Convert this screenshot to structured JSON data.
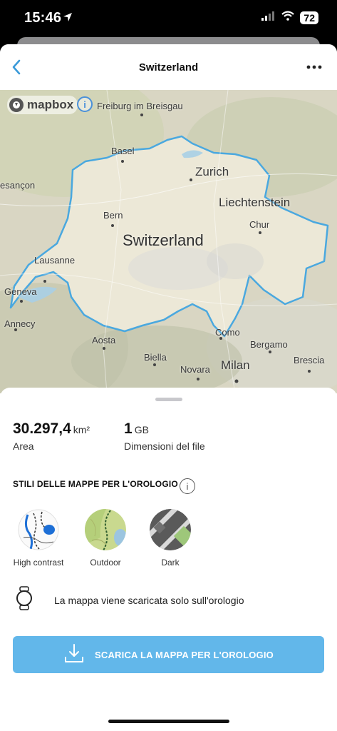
{
  "status_bar": {
    "time": "15:46",
    "battery": "72"
  },
  "header": {
    "title": "Switzerland"
  },
  "map": {
    "attribution": "mapbox",
    "labels": {
      "freiburg": "Freiburg im Breisgau",
      "basel": "Basel",
      "zurich": "Zurich",
      "besancon": "esançon",
      "liechtenstein": "Liechtenstein",
      "bern": "Bern",
      "chur": "Chur",
      "switzerland": "Switzerland",
      "lausanne": "Lausanne",
      "geneva": "Geneva",
      "annecy": "Annecy",
      "como": "Como",
      "bergamo": "Bergamo",
      "aosta": "Aosta",
      "biella": "Biella",
      "brescia": "Brescia",
      "novara": "Novara",
      "milan": "Milan"
    }
  },
  "stats": {
    "area_value": "30.297,4",
    "area_unit": "km²",
    "area_label": "Area",
    "size_value": "1",
    "size_unit": "GB",
    "size_label": "Dimensioni del file"
  },
  "styles_section": {
    "title": "STILI DELLE MAPPE PER L'OROLOGIO",
    "items": [
      {
        "label": "High contrast"
      },
      {
        "label": "Outdoor"
      },
      {
        "label": "Dark"
      }
    ]
  },
  "info_text": "La mappa viene scaricata solo sull'orologio",
  "download_button": {
    "label": "SCARICA LA MAPPA PER L'OROLOGIO"
  },
  "colors": {
    "accent": "#62b7ea",
    "border": "#4aa8df"
  }
}
